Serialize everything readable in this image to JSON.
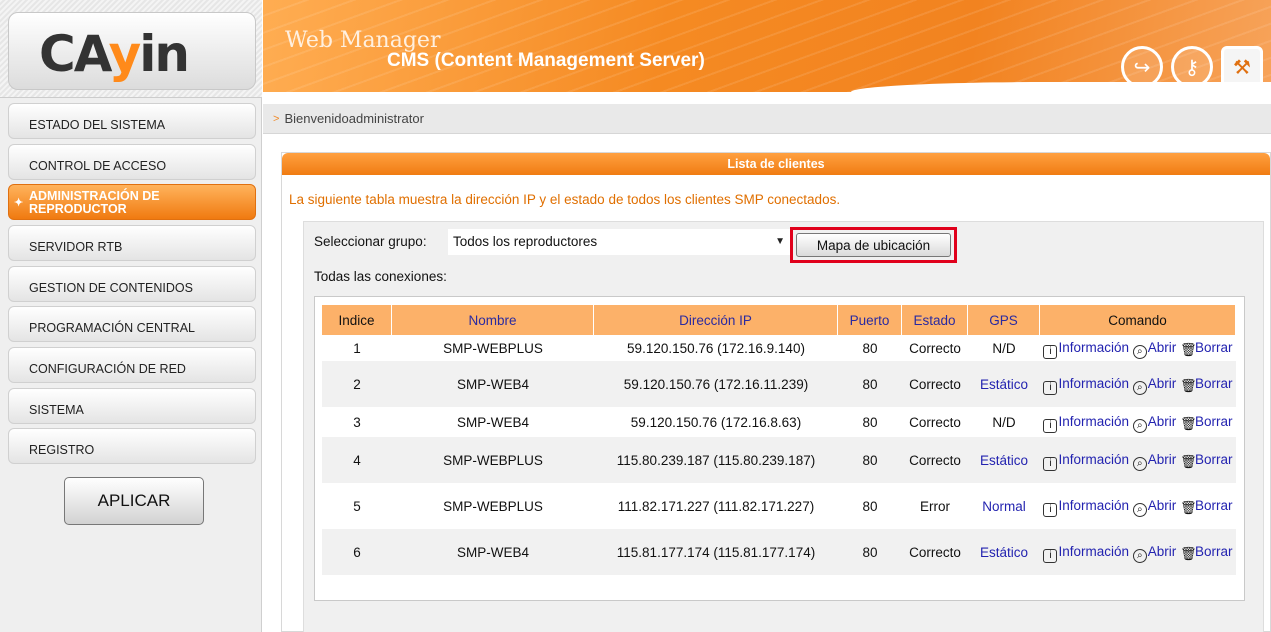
{
  "logo": {
    "text_prefix": "CA",
    "text_suffix": "in",
    "text_y": "y"
  },
  "header": {
    "web_manager": "Web Manager",
    "title": "CMS (Content Management Server)",
    "icons": [
      "logout-icon",
      "key-icon",
      "tool-icon"
    ]
  },
  "sidebar": {
    "items": [
      {
        "label": "ESTADO DEL SISTEMA"
      },
      {
        "label": "CONTROL DE ACCESO"
      },
      {
        "label": "ADMINISTRACIÓN DE REPRODUCTOR"
      },
      {
        "label": "SERVIDOR RTB"
      },
      {
        "label": "GESTION DE CONTENIDOS"
      },
      {
        "label": "PROGRAMACIÓN CENTRAL"
      },
      {
        "label": "CONFIGURACIÓN DE RED"
      },
      {
        "label": "SISTEMA"
      },
      {
        "label": "REGISTRO"
      }
    ],
    "apply_label": "APLICAR"
  },
  "breadcrumb": {
    "arrow": ">",
    "text": "Bienvenidoadministrator"
  },
  "panel": {
    "title": "Lista de clientes",
    "description": "La siguiente tabla muestra la dirección IP y el estado de todos los clientes SMP conectados.",
    "group_label": "Seleccionar grupo:",
    "group_value": "Todos los reproductores",
    "map_button": "Mapa de ubicación",
    "connections_label": "Todas las conexiones:"
  },
  "table": {
    "headers": [
      "Indice",
      "Nombre",
      "Dirección IP",
      "Puerto",
      "Estado",
      "GPS",
      "Comando"
    ],
    "rows": [
      {
        "index": "1",
        "name": "SMP-WEBPLUS",
        "ip": "59.120.150.76 (172.16.9.140)",
        "port": "80",
        "state": "Correcto",
        "gps": "N/D"
      },
      {
        "index": "2",
        "name": "SMP-WEB4",
        "ip": "59.120.150.76 (172.16.11.239)",
        "port": "80",
        "state": "Correcto",
        "gps": "Estático"
      },
      {
        "index": "3",
        "name": "SMP-WEB4",
        "ip": "59.120.150.76 (172.16.8.63)",
        "port": "80",
        "state": "Correcto",
        "gps": "N/D"
      },
      {
        "index": "4",
        "name": "SMP-WEBPLUS",
        "ip": "115.80.239.187 (115.80.239.187)",
        "port": "80",
        "state": "Correcto",
        "gps": "Estático"
      },
      {
        "index": "5",
        "name": "SMP-WEBPLUS",
        "ip": "111.82.171.227 (111.82.171.227)",
        "port": "80",
        "state": "Error",
        "gps": "Normal"
      },
      {
        "index": "6",
        "name": "SMP-WEB4",
        "ip": "115.81.177.174 (115.81.177.174)",
        "port": "80",
        "state": "Correcto",
        "gps": "Estático"
      }
    ],
    "commands": {
      "info": "Información",
      "open": "Abrir",
      "delete": "Borrar"
    }
  }
}
